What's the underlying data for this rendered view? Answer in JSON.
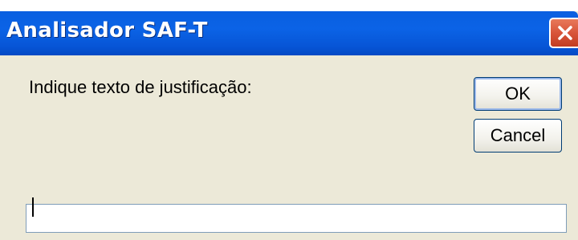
{
  "window": {
    "title": "Analisador SAF-T",
    "close_icon": "close-icon"
  },
  "dialog": {
    "prompt": "Indique texto de justificação:",
    "input_value": "",
    "ok_label": "OK",
    "cancel_label": "Cancel"
  },
  "colors": {
    "titlebar": "#0b63e6",
    "window_bg": "#ece9d8",
    "close_button": "#d8553a",
    "button_border": "#003c74",
    "input_border": "#7f9db9"
  }
}
